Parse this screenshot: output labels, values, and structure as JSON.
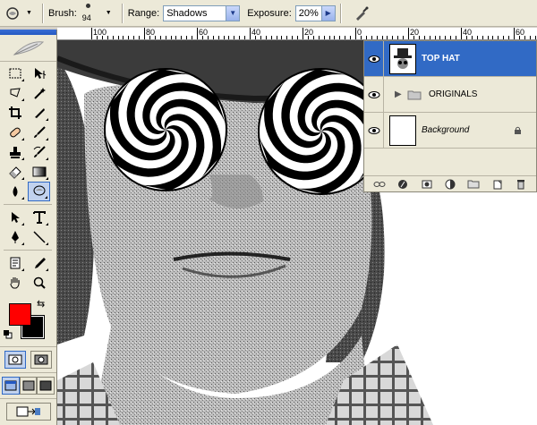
{
  "options_bar": {
    "tool_preset_icon": "dodge-tool-icon",
    "brush_label": "Brush:",
    "brush_size": "94",
    "range_label": "Range:",
    "range_value": "Shadows",
    "exposure_label": "Exposure:",
    "exposure_value": "20%",
    "airbrush_icon": "airbrush-icon"
  },
  "ruler": {
    "labels": [
      "100",
      "80",
      "60",
      "40",
      "20",
      "0",
      "20",
      "40",
      "60"
    ]
  },
  "toolbox": {
    "tools": [
      "rectangular-marquee-icon",
      "move-icon",
      "lasso-icon",
      "magic-wand-icon",
      "crop-icon",
      "slice-icon",
      "healing-brush-icon",
      "brush-icon",
      "clone-stamp-icon",
      "history-brush-icon",
      "eraser-icon",
      "gradient-icon",
      "blur-icon",
      "dodge-icon",
      "path-selection-icon",
      "type-icon",
      "pen-icon",
      "line-icon",
      "notes-icon",
      "eyedropper-icon",
      "hand-icon",
      "zoom-icon"
    ],
    "foreground_color": "#ff0000",
    "background_color": "#000000"
  },
  "layers": {
    "items": [
      {
        "name": "TOP HAT",
        "selected": true,
        "type": "layer"
      },
      {
        "name": "ORIGINALS",
        "selected": false,
        "type": "group"
      },
      {
        "name": "Background",
        "selected": false,
        "type": "background",
        "locked": true
      }
    ],
    "footer_icons": [
      "link-icon",
      "fx-icon",
      "mask-icon",
      "adjustment-icon",
      "group-icon",
      "new-layer-icon",
      "trash-icon"
    ]
  },
  "colors": {
    "selection_blue": "#316ac5",
    "panel_bg": "#ece9d8"
  }
}
